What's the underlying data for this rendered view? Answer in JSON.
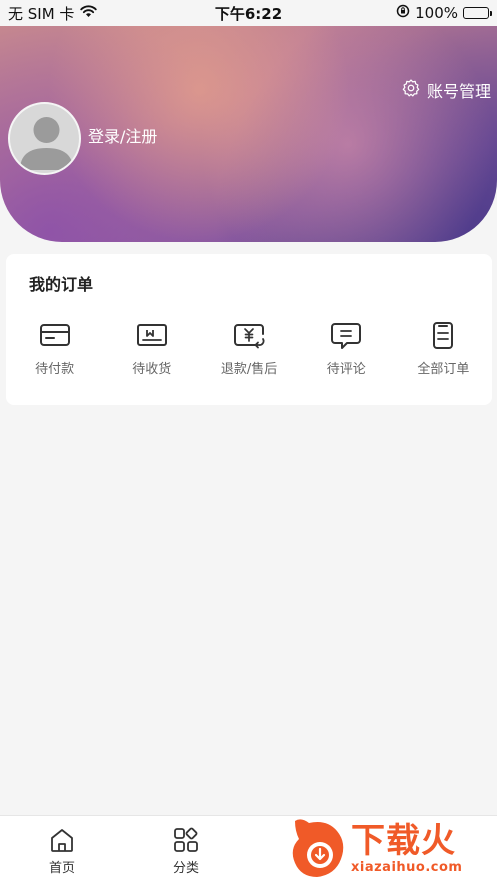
{
  "status_bar": {
    "carrier": "无 SIM 卡",
    "time": "下午6:22",
    "battery": "100%",
    "battery_level": 1.0
  },
  "header": {
    "account_management": "账号管理",
    "login_register": "登录/注册"
  },
  "orders": {
    "title": "我的订单",
    "items": [
      {
        "label": "待付款",
        "icon": "card-icon"
      },
      {
        "label": "待收货",
        "icon": "box-icon"
      },
      {
        "label": "退款/售后",
        "icon": "refund-icon"
      },
      {
        "label": "待评论",
        "icon": "comment-icon"
      },
      {
        "label": "全部订单",
        "icon": "clipboard-icon"
      }
    ]
  },
  "tabbar": {
    "tabs": [
      {
        "label": "首页",
        "icon": "home-icon"
      },
      {
        "label": "分类",
        "icon": "category-icon"
      }
    ]
  },
  "watermark": {
    "brand": "下载火",
    "url": "xiazaihuo.com"
  },
  "colors": {
    "accent": "#f05a28",
    "icon": "#333333",
    "label": "#666666"
  }
}
